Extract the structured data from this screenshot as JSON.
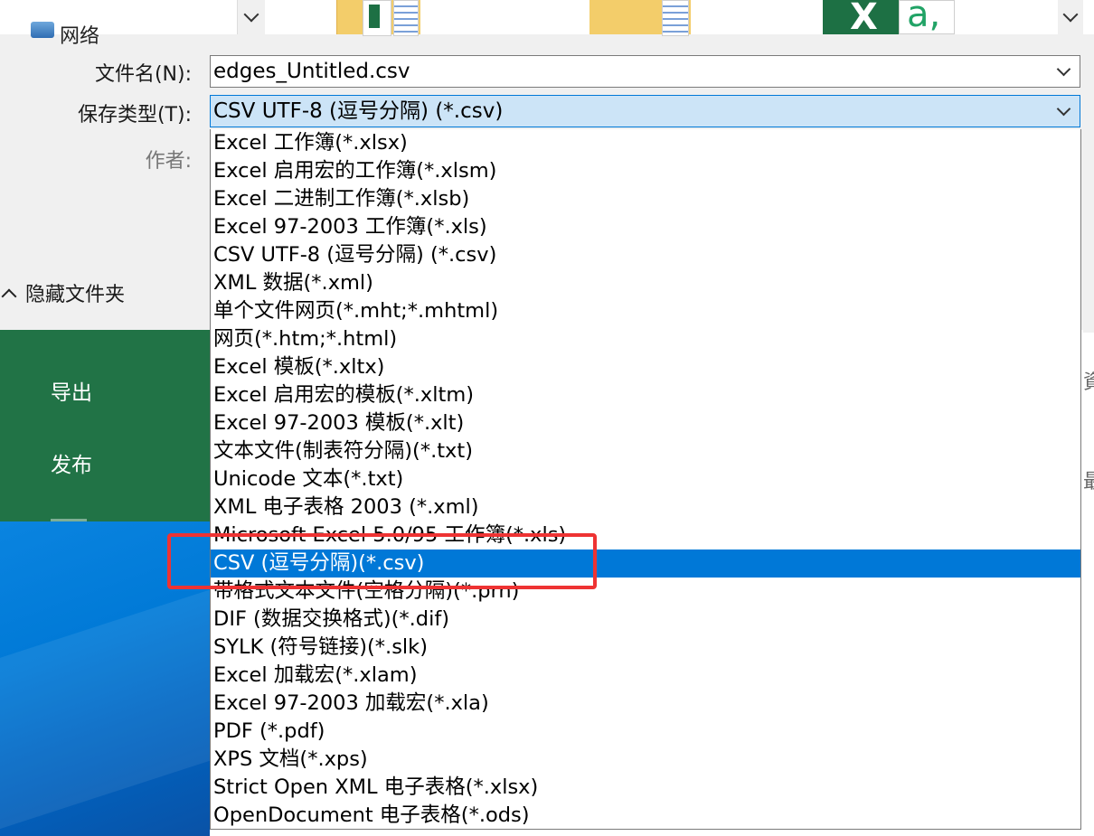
{
  "navigation": {
    "network_label": "网络"
  },
  "file_thumbnails": {
    "excel_thumb_letter": "X",
    "excel_thumb_text": "a,"
  },
  "file_name": {
    "label": "文件名(N):",
    "value": "edges_Untitled.csv"
  },
  "save_type": {
    "label": "保存类型(T):",
    "value": "CSV UTF-8 (逗号分隔) (*.csv)",
    "options": [
      "Excel 工作簿(*.xlsx)",
      "Excel 启用宏的工作簿(*.xlsm)",
      "Excel 二进制工作簿(*.xlsb)",
      "Excel 97-2003 工作簿(*.xls)",
      "CSV UTF-8 (逗号分隔) (*.csv)",
      "XML 数据(*.xml)",
      "单个文件网页(*.mht;*.mhtml)",
      "网页(*.htm;*.html)",
      "Excel 模板(*.xltx)",
      "Excel 启用宏的模板(*.xltm)",
      "Excel 97-2003 模板(*.xlt)",
      "文本文件(制表符分隔)(*.txt)",
      "Unicode 文本(*.txt)",
      "XML 电子表格 2003 (*.xml)",
      "Microsoft Excel 5.0/95 工作簿(*.xls)",
      "CSV (逗号分隔)(*.csv)",
      "带格式文本文件(空格分隔)(*.prn)",
      "DIF (数据交换格式)(*.dif)",
      "SYLK (符号链接)(*.slk)",
      "Excel 加载宏(*.xlam)",
      "Excel 97-2003 加载宏(*.xla)",
      "PDF (*.pdf)",
      "XPS 文档(*.xps)",
      "Strict Open XML 电子表格(*.xlsx)",
      "OpenDocument 电子表格(*.ods)"
    ],
    "highlighted_index": 15
  },
  "author": {
    "label": "作者:"
  },
  "hide_folders": {
    "label": "隐藏文件夹"
  },
  "backstage_menu": {
    "items": [
      "导出",
      "发布"
    ]
  },
  "right_edge_chars": [
    "資",
    "最"
  ],
  "colors": {
    "selection_blue": "#0078d7",
    "excel_green": "#217346",
    "field_focus": "#cce4f7",
    "annotation_red": "#ee3333"
  }
}
